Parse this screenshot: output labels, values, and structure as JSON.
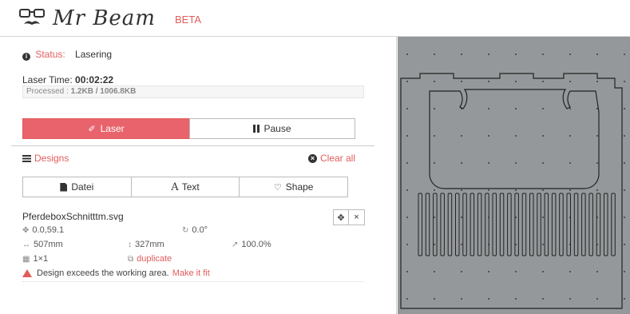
{
  "app": {
    "logo_text": "Mr Beam",
    "beta_label": "BETA"
  },
  "status": {
    "label": "Status:",
    "value": "Lasering"
  },
  "laser_time": {
    "label": "Laser Time:",
    "value": "00:02:22"
  },
  "processed": {
    "label": "Processed :",
    "value": "1.2KB / 1006.8KB"
  },
  "controls": {
    "laser_label": "Laser",
    "pause_label": "Pause"
  },
  "designs": {
    "title": "Designs",
    "clear_all_label": "Clear all",
    "tabs": [
      {
        "label": "Datei",
        "icon": "file-icon"
      },
      {
        "label": "Text",
        "icon": "text-icon"
      },
      {
        "label": "Shape",
        "icon": "heart-icon"
      }
    ]
  },
  "design_item": {
    "filename": "PferdeboxSchnitttm.svg",
    "position": "0.0,59.1",
    "rotation": "0.0°",
    "width": "507mm",
    "height": "327mm",
    "scale": "100.0%",
    "grid": "1×1",
    "duplicate_label": "duplicate",
    "warning_text": "Design exceeds the working area.",
    "warning_link": "Make it fit"
  },
  "colors": {
    "accent": "#e25c5c",
    "laser_button": "#e8636b",
    "workarea_bg": "#94989a"
  }
}
